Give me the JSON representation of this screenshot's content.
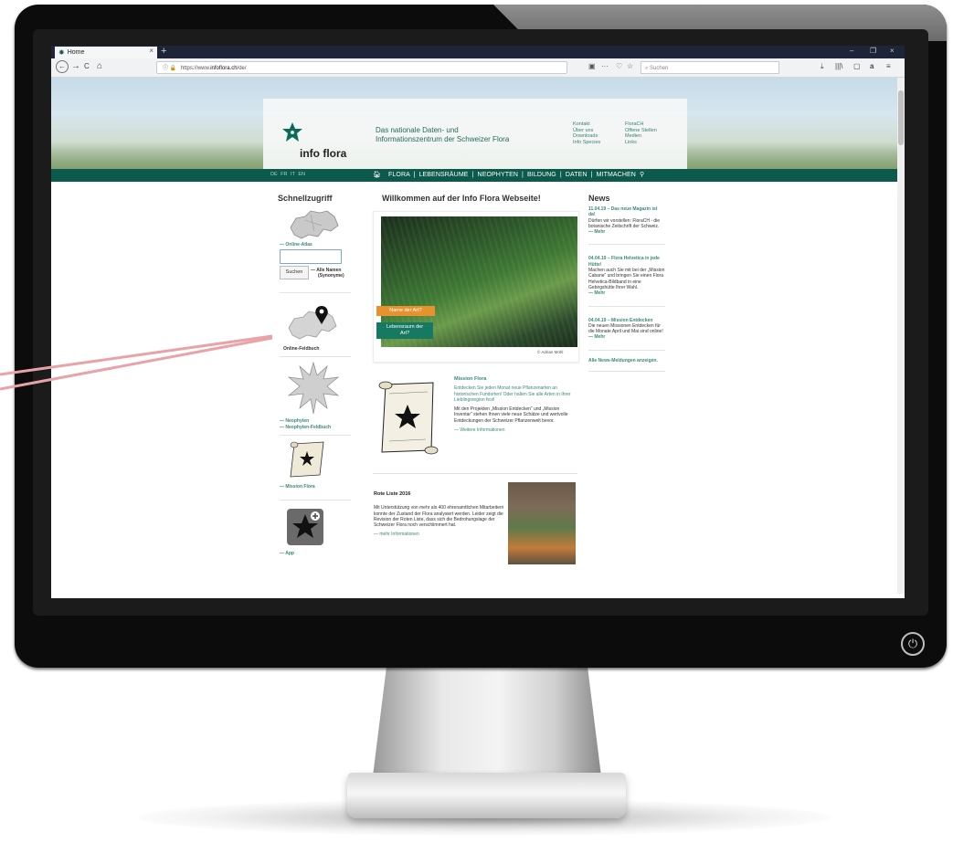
{
  "browser": {
    "tab_title": "Home",
    "tab_close": "×",
    "new_tab": "+",
    "window_controls": [
      "–",
      "❐",
      "×"
    ],
    "nav_icons": [
      "←",
      "→",
      "C",
      "⌂"
    ],
    "url_prefix": "ⓘ",
    "url_scheme": "https://www.",
    "url_domain": "infoflora.ch",
    "url_path": "/de/",
    "url_icons": [
      "▣",
      "···",
      "♡",
      "☆"
    ],
    "search_placeholder": "Suchen",
    "toolbar_icons": [
      "⤓",
      "|||\\",
      "▢",
      "a",
      "≡"
    ]
  },
  "site": {
    "logo_text": "info flora",
    "tagline_line1": "Das nationale Daten- und",
    "tagline_line2": "Informationszentrum der Schweizer Flora",
    "top_links_left": [
      "Kontakt",
      "Über uns",
      "Downloads",
      "Info Species"
    ],
    "top_links_right": [
      "FloraCH",
      "Offene Stellen",
      "Medien",
      "Links"
    ],
    "languages": [
      "DE",
      "FR",
      "IT",
      "EN"
    ],
    "menu": [
      "FLORA",
      "LEBENSRÄUME",
      "NEOPHYTEN",
      "BILDUNG",
      "DATEN",
      "MITMACHEN"
    ],
    "menu_search_icon": "search-icon"
  },
  "quick": {
    "heading": "Schnellzugriff",
    "atlas_link": "— Online-Atlas",
    "search_button": "Suchen",
    "alle_namen_line1": "— Alle Namen",
    "alle_namen_line2": "(Synonyme)",
    "feldbuch_link": "Online-Feldbuch",
    "neophyten_link": "— Neophyten",
    "neophyten_feldbuch_link": "— Neophyten-Feldbuch",
    "mission_link": "— Mission Flora",
    "app_link": "— App"
  },
  "main": {
    "heading": "Willkommen auf der Info Flora Webseite!",
    "tag_name": "Name der Art?",
    "tag_habitat_line1": "Lebensraum der",
    "tag_habitat_line2": "Art?",
    "photo_credit": "© Adrian Möhl",
    "mission_title": "Mission Flora",
    "mission_text1": "Entdecken Sie jeden Monat neue Pflanzenarten an historischen Fundorten! Oder halten Sie alle Arten in Ihrer Lieblingsregion fest!",
    "mission_text2": "Mit den Projekten „Mission Entdecken“ und „Mission Inventar“ stehen Ihnen viele neue Schätze und wertvolle Entdeckungen der Schweizer Pflanzenwelt bevor.",
    "mission_more": "— Weitere Informationen",
    "rote_title": "Rote Liste 2016",
    "rote_text": "Mit Unterstützung von mehr als 400 ehrenamtlichen Mitarbeitern konnte der Zustand der Flora analysiert werden. Leider zeigt die Revision der Roten Liste, dass sich die Bedrohungslage der Schweizer Flora noch verschlimmert hat.",
    "rote_more": "— mehr Informationen"
  },
  "news": {
    "heading": "News",
    "items": [
      {
        "title": "11.04.19 – Das neue Magazin ist da!",
        "text": "Dürfen wir vorstellen: FloraCH - die botanische Zeitschrift der Schweiz.",
        "more": "— Mehr"
      },
      {
        "title": "04.04.19 – Flora Helvetica in jede Hütte!",
        "text": "Machen auch Sie mit bei der „Mission Cabane“ und bringen Sie einen Flora Helvetica-Bildband in eine Gebirgshütte Ihrer Wahl.",
        "more": "— Mehr"
      },
      {
        "title": "04.04.19 – Mission Entdecken",
        "text": "Die neuen Missionen Entdecken für die Monate April und Mai sind online!",
        "more": "— Mehr"
      }
    ],
    "all_link": "Alle News-Meldungen anzeigen."
  },
  "colors": {
    "brand_green": "#0c5a4c",
    "link_green": "#3a8a78",
    "orange_tag": "#e6932f",
    "teal_tag": "#167a63",
    "callout_line": "#e8a3a8"
  }
}
